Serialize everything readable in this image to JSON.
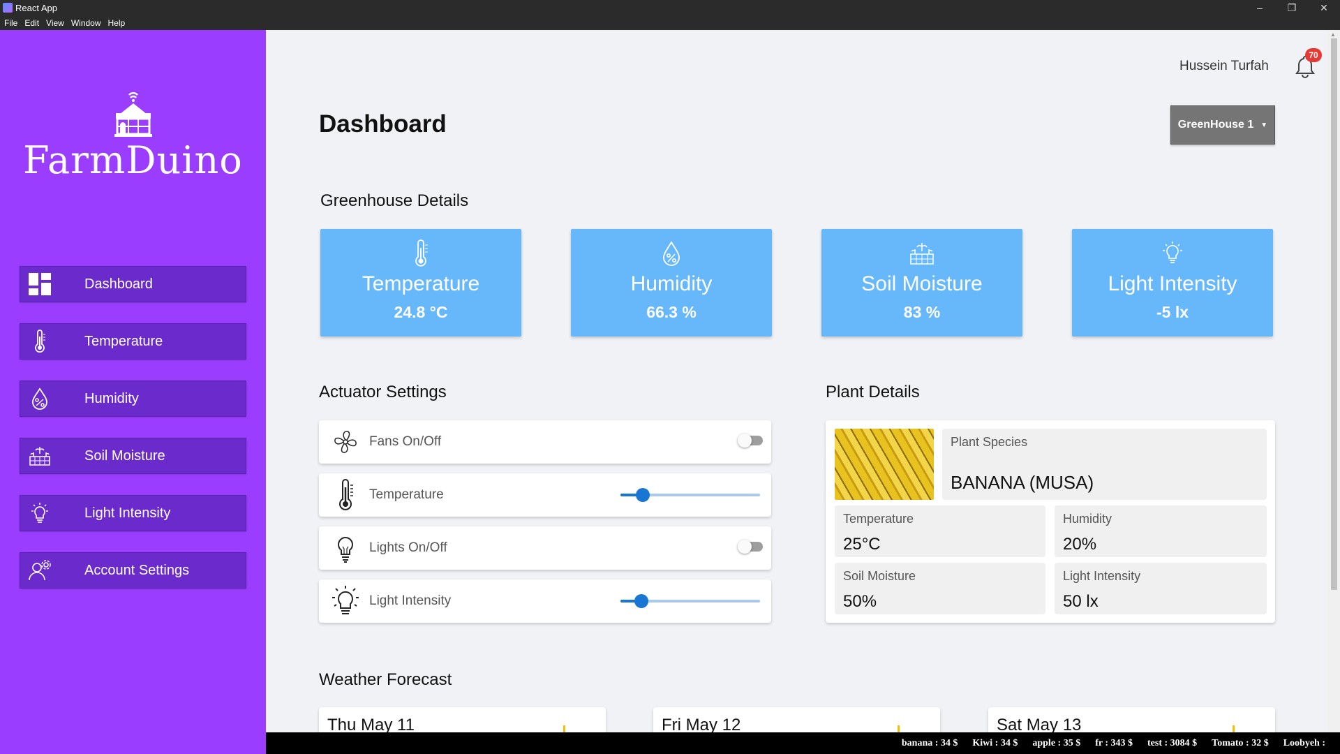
{
  "window": {
    "title": "React App",
    "minimize": "–",
    "restore": "❐",
    "close": "✕"
  },
  "menu": [
    "File",
    "Edit",
    "View",
    "Window",
    "Help"
  ],
  "brand": {
    "name": "FarmDuino",
    "bg_color": "#9a3dff",
    "nav_color": "#6b2bcc"
  },
  "sidebar": {
    "items": [
      {
        "label": "Dashboard",
        "icon": "dashboard-icon"
      },
      {
        "label": "Temperature",
        "icon": "thermometer-icon"
      },
      {
        "label": "Humidity",
        "icon": "humidity-icon"
      },
      {
        "label": "Soil Moisture",
        "icon": "soil-moisture-icon"
      },
      {
        "label": "Light Intensity",
        "icon": "lightbulb-icon"
      },
      {
        "label": "Account Settings",
        "icon": "account-settings-icon"
      }
    ]
  },
  "header": {
    "user_name": "Hussein Turfah",
    "notification_count": "70",
    "page_title": "Dashboard",
    "greenhouse_select": "GreenHouse 1"
  },
  "greenhouse_details": {
    "title": "Greenhouse Details",
    "card_color": "#67b8fb",
    "cards": [
      {
        "label": "Temperature",
        "value": "24.8 °C",
        "icon": "thermometer-icon"
      },
      {
        "label": "Humidity",
        "value": "66.3 %",
        "icon": "humidity-icon"
      },
      {
        "label": "Soil Moisture",
        "value": "83 %",
        "icon": "soil-moisture-icon"
      },
      {
        "label": "Light Intensity",
        "value": "-5 lx",
        "icon": "lightbulb-icon"
      }
    ]
  },
  "actuators": {
    "title": "Actuator Settings",
    "items": [
      {
        "label": "Fans On/Off",
        "icon": "fan-icon",
        "control": "switch",
        "on": false
      },
      {
        "label": "Temperature",
        "icon": "thermometer-icon",
        "control": "slider",
        "level": 0.16
      },
      {
        "label": "Lights On/Off",
        "icon": "lightbulb-icon",
        "control": "switch",
        "on": false
      },
      {
        "label": "Light Intensity",
        "icon": "lightbulb-glow-icon",
        "control": "slider",
        "level": 0.15
      }
    ]
  },
  "plant": {
    "title": "Plant Details",
    "species_label": "Plant Species",
    "species": "BANANA (MUSA)",
    "stats": [
      {
        "label": "Temperature",
        "value": "25°C"
      },
      {
        "label": "Humidity",
        "value": "20%"
      },
      {
        "label": "Soil Moisture",
        "value": "50%"
      },
      {
        "label": "Light Intensity",
        "value": "50 lx"
      }
    ]
  },
  "weather": {
    "title": "Weather Forecast",
    "days": [
      "Thu May 11",
      "Fri May 12",
      "Sat May 13"
    ]
  },
  "ticker": [
    "banana : 34 $",
    "Kiwi : 34 $",
    "apple : 35 $",
    "fr : 343 $",
    "test : 3084 $",
    "Tomato : 32 $",
    "Loobyeh :"
  ]
}
